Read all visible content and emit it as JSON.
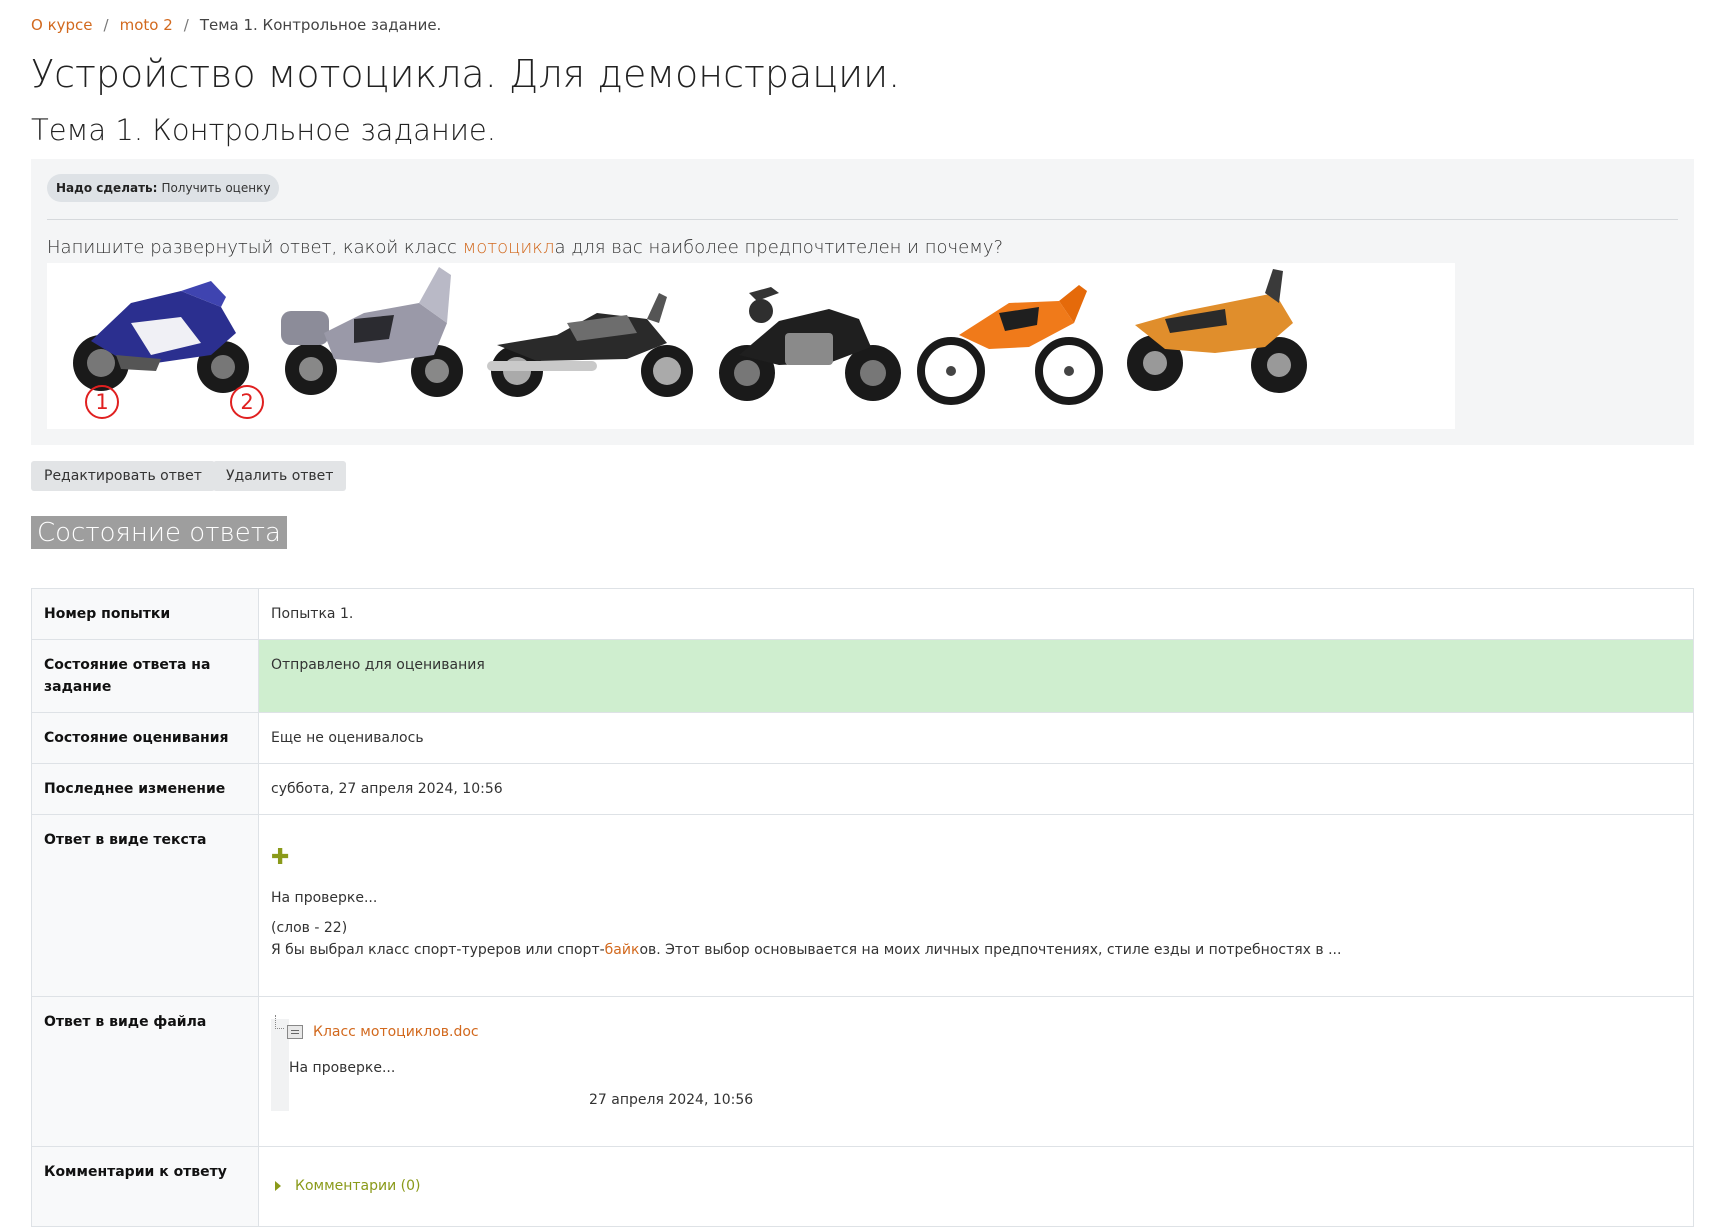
{
  "breadcrumb": {
    "item1": "О курсе",
    "item2": "moto 2",
    "current": "Тема 1. Контрольное задание.",
    "separator": "/"
  },
  "course_title": "Устройство мотоцикла. Для демонстрации.",
  "activity_title": "Тема 1. Контрольное задание.",
  "todo": {
    "label": "Надо сделать:",
    "value": "Получить оценку"
  },
  "question": {
    "before": "Напишите развернутый ответ, какой класс ",
    "keyword": "мотоцикл",
    "after": "а для вас наиболее предпочтителен и почему?"
  },
  "markers": [
    "1",
    "2"
  ],
  "buttons": {
    "edit": "Редактировать ответ",
    "delete": "Удалить ответ"
  },
  "status_heading": "Состояние ответа",
  "table": {
    "attempt_label": "Номер попытки",
    "attempt_value": "Попытка 1.",
    "submission_label": "Состояние ответа на задание",
    "submission_value": "Отправлено для оценивания",
    "grading_label": "Состояние оценивания",
    "grading_value": "Еще не оценивалось",
    "modified_label": "Последнее изменение",
    "modified_value": "суббота, 27 апреля 2024, 10:56",
    "text_label": "Ответ в виде текста",
    "text_status": "На проверке...",
    "word_count": "(слов - 22)",
    "text_before": "Я бы выбрал класс спорт-туреров или спорт-",
    "text_keyword": "байк",
    "text_after": "ов. Этот выбор основывается на моих личных предпочтениях, стиле езды и потребностях в ...",
    "file_label": "Ответ в виде файла",
    "file_name": "Класс мотоциклов.doc",
    "file_status": "На проверке...",
    "file_date": "27 апреля 2024, 10:56",
    "comments_label": "Комментарии к ответу",
    "comments_link": "Комментарии (0)"
  },
  "colors": {
    "link": "#d2691e",
    "submitted_bg": "#cfeecf",
    "olive": "#8a9a1a",
    "marker": "#e02020"
  },
  "icons": [
    "plus-icon",
    "doc-icon",
    "expand-triangle-icon"
  ]
}
